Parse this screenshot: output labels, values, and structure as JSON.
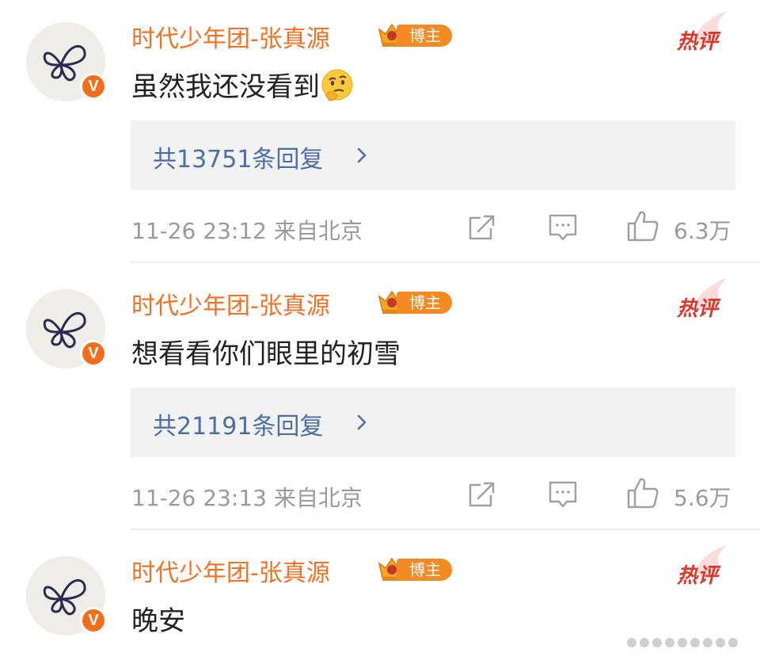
{
  "comments": [
    {
      "username": "时代少年团-张真源",
      "badge_label": "博主",
      "hot_label": "热评",
      "text": "虽然我还没看到",
      "emoji": "thinking-face-emoji",
      "reply_link": "共13751条回复",
      "time": "11-26 23:12",
      "location": "来自北京",
      "likes": "6.3万"
    },
    {
      "username": "时代少年团-张真源",
      "badge_label": "博主",
      "hot_label": "热评",
      "text": "想看看你们眼里的初雪",
      "reply_link": "共21191条回复",
      "time": "11-26 23:13",
      "location": "来自北京",
      "likes": "5.6万"
    },
    {
      "username": "时代少年团-张真源",
      "badge_label": "博主",
      "hot_label": "热评",
      "text": "晚安"
    }
  ],
  "avatar_badge": "V",
  "colors": {
    "username": "#f47121",
    "reply_link": "#4a6ea8",
    "hot": "#e3342a",
    "meta": "#9a9a9a",
    "badge": "#f58a22"
  }
}
